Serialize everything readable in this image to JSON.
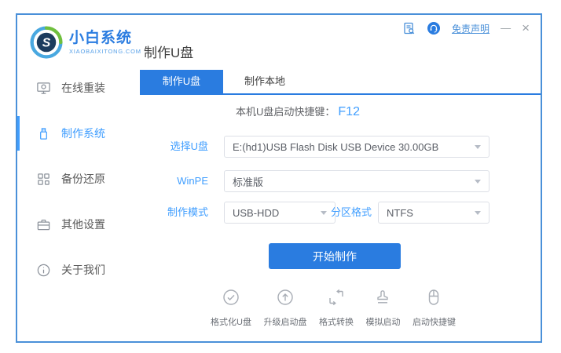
{
  "brand": {
    "name": "小白系统",
    "domain": "XIAOBAIXITONG.COM"
  },
  "page_title": "制作U盘",
  "titlebar": {
    "disclaimer_link": "免责声明",
    "minimize_glyph": "—",
    "close_glyph": "×"
  },
  "sidebar": {
    "items": [
      {
        "label": "在线重装",
        "icon": "monitor-reinstall-icon",
        "active": false
      },
      {
        "label": "制作系统",
        "icon": "usb-drive-icon",
        "active": true
      },
      {
        "label": "备份还原",
        "icon": "backup-grid-icon",
        "active": false
      },
      {
        "label": "其他设置",
        "icon": "briefcase-icon",
        "active": false
      },
      {
        "label": "关于我们",
        "icon": "info-circle-icon",
        "active": false
      }
    ]
  },
  "tabs": [
    {
      "label": "制作U盘",
      "active": true
    },
    {
      "label": "制作本地",
      "active": false
    }
  ],
  "form": {
    "hotkey_label": "本机U盘启动快捷键：",
    "hotkey_value": "F12",
    "usb_select": {
      "label": "选择U盘",
      "value": "E:(hd1)USB Flash Disk USB Device 30.00GB"
    },
    "winpe_select": {
      "label": "WinPE",
      "value": "标准版"
    },
    "mode_select": {
      "label": "制作模式",
      "value": "USB-HDD"
    },
    "partition_select": {
      "label": "分区格式",
      "value": "NTFS"
    },
    "start_button": "开始制作"
  },
  "toolbar": {
    "items": [
      {
        "label": "格式化U盘",
        "icon": "check-circle-icon"
      },
      {
        "label": "升级启动盘",
        "icon": "arrow-up-circle-icon"
      },
      {
        "label": "格式转换",
        "icon": "format-convert-icon"
      },
      {
        "label": "模拟启动",
        "icon": "stamp-icon"
      },
      {
        "label": "启动快捷键",
        "icon": "mouse-icon"
      }
    ]
  },
  "colors": {
    "primary_blue": "#2a7ce0",
    "label_blue": "#409eff",
    "window_border": "#4a90d9",
    "field_border": "#dcdfe6",
    "text_dark": "#3f3f3f",
    "text_gray": "#595959",
    "icon_gray": "#a8adb5"
  }
}
